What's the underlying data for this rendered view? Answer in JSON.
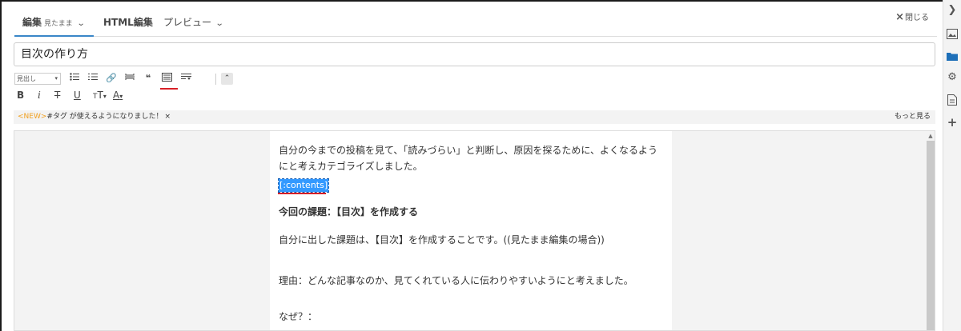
{
  "tabs": {
    "edit_label": "編集",
    "edit_mode": "見たまま",
    "html_label": "HTML編集",
    "preview_label": "プレビュー"
  },
  "close_label": "閉じる",
  "title_value": "目次の作り方",
  "toolbar": {
    "heading_select": "見出し",
    "bold": "B",
    "italic": "i",
    "strike": "T",
    "underline": "U",
    "font_size": "T",
    "font_color": "A"
  },
  "notice": {
    "new_tag": "<NEW>",
    "message": "#タグ が使えるようになりました！",
    "dismiss": "×",
    "more": "もっと見る"
  },
  "editor": {
    "p1": "自分の今までの投稿を見て、「読みづらい」と判断し、原因を探るために、よくなるようにと考えカテゴライズしました。",
    "contents_tag": "[:contents]",
    "p3": "今回の課題：【目次】を作成する",
    "p4": "自分に出した課題は、【目次】を作成することです。((見たまま編集の場合))",
    "p5": "理由：どんな記事なのか、見てくれている人に伝わりやすいようにと考えました。",
    "p6": "なぜ？："
  }
}
